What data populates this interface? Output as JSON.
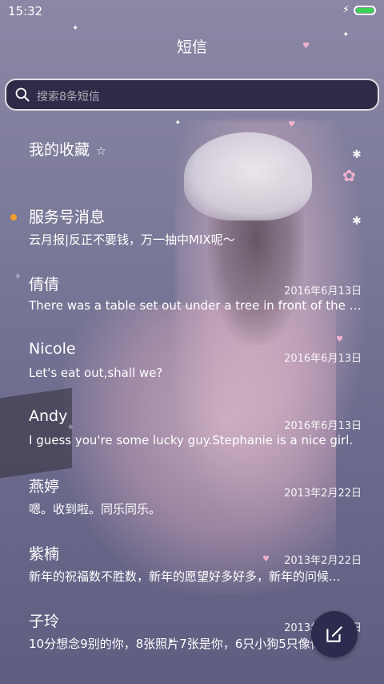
{
  "status_bar": {
    "time": "15:32",
    "battery_color": "#39d353"
  },
  "header": {
    "title": "短信"
  },
  "search": {
    "placeholder": "搜索8条短信"
  },
  "conversations": [
    {
      "name": "我的收藏",
      "date": "",
      "preview": "",
      "icon": "star-icon"
    },
    {
      "name": "服务号消息",
      "date": "",
      "preview": "云月报|反正不要钱，万一抽中MIX呢～",
      "unread": true
    },
    {
      "name": "倩倩",
      "date": "2016年6月13日",
      "preview": "There was a table set out under a tree in front of the ho..."
    },
    {
      "name": "Nicole",
      "date": "2016年6月13日",
      "preview": "Let's eat out,shall we?"
    },
    {
      "name": "Andy",
      "date": "2016年6月13日",
      "preview": "I guess you're some lucky guy.Stephanie is a nice girl."
    },
    {
      "name": "燕婷",
      "date": "2013年2月22日",
      "preview": "嗯。收到啦。同乐同乐。"
    },
    {
      "name": "紫楠",
      "date": "2013年2月22日",
      "preview": "新年的祝福数不胜数，新年的愿望好多好多，新年的问候..."
    },
    {
      "name": "子玲",
      "date": "2013年2月22日",
      "preview": "10分想念9别的你，8张照片7张是你，6只小狗5只像你..."
    }
  ],
  "compose": {
    "icon": "compose-icon"
  },
  "colors": {
    "unread_dot": "#f0a030",
    "search_bg": "#1e1c38",
    "compose_bg": "#2d2c4e"
  }
}
